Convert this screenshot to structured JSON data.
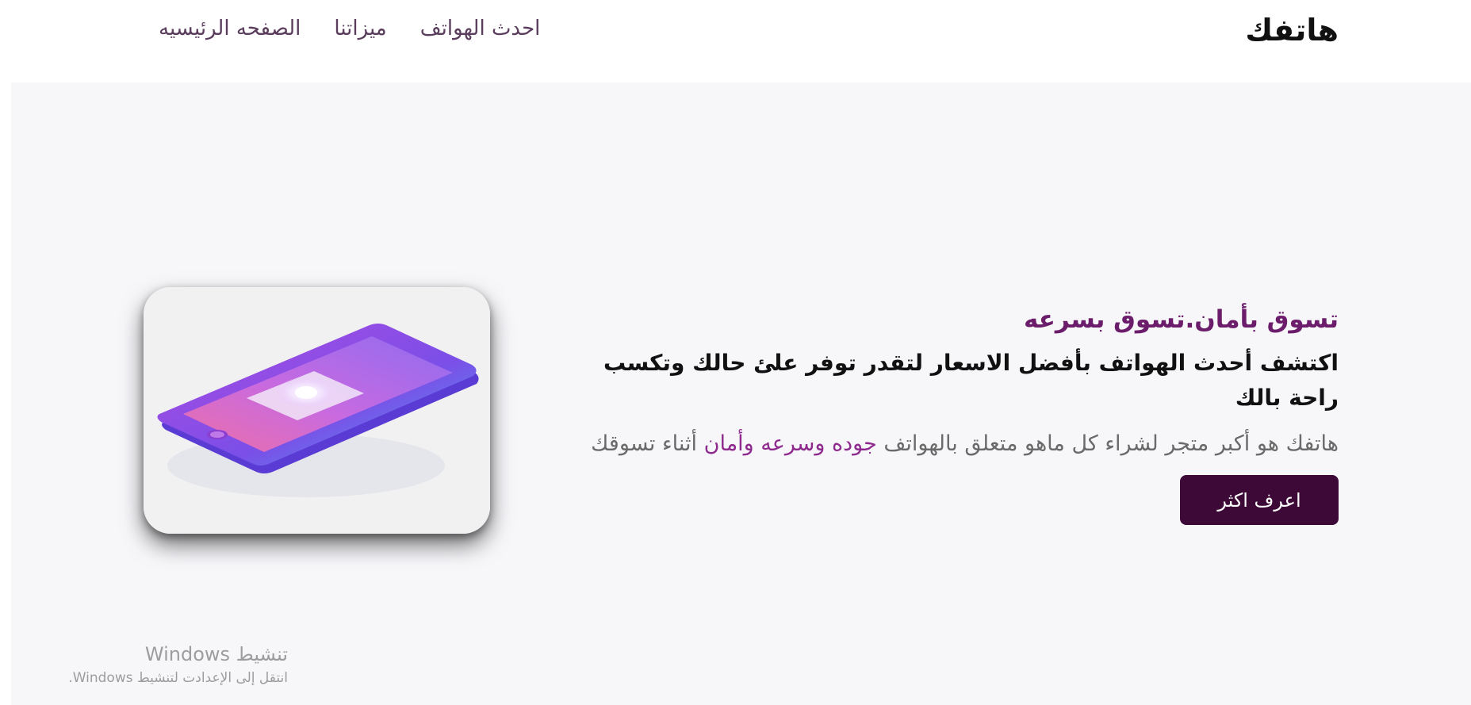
{
  "brand": {
    "name": "هاتفك"
  },
  "nav": {
    "items": [
      {
        "label": "الصفحه الرئيسيه"
      },
      {
        "label": "ميزاتنا"
      },
      {
        "label": "احدث الهواتف"
      }
    ]
  },
  "hero": {
    "tagline": "تسوق بأمان.تسوق بسرعه",
    "headline": "اكتشف أحدث الهواتف بأفضل الاسعار لتقدر توفر علئ حالك وتكسب راحة بالك",
    "description_part1": "هاتفك هو أكبر متجر لشراء كل ماهو متعلق بالهواتف ",
    "description_highlight": "جوده وسرعه وأمان",
    "description_part2": " أثناء تسوقك",
    "cta_label": "اعرف اكثر",
    "image_icon": "smartphone-illustration"
  },
  "windows_activation": {
    "title": "تنشيط Windows",
    "subtitle": "انتقل إلى الإعدادت لتنشيط Windows."
  },
  "colors": {
    "brand_accent": "#6b1d6b",
    "highlight": "#8e2a8e",
    "button_bg": "#3d0a38",
    "hero_bg": "#f7f7fa"
  }
}
